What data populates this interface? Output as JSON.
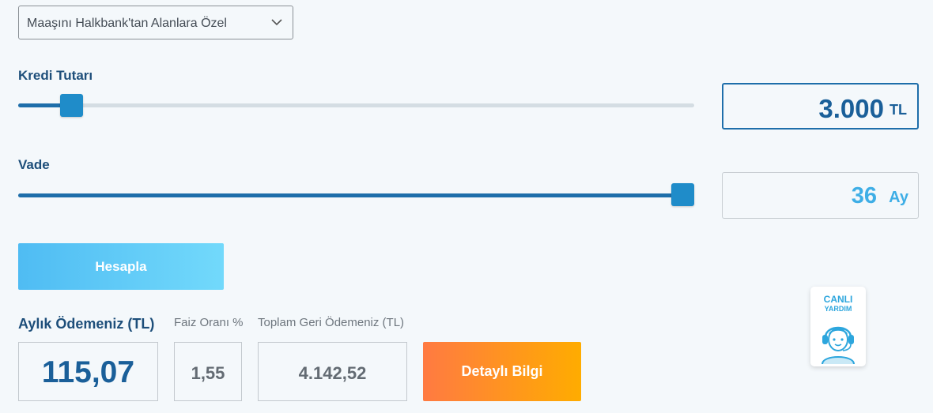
{
  "loan_type_select": {
    "selected": "Maaşını Halkbank'tan Alanlara Özel"
  },
  "amount": {
    "label": "Kredi Tutarı",
    "value": "3.000",
    "unit": "TL",
    "slider_fraction": 0.04
  },
  "term": {
    "label": "Vade",
    "value": "36",
    "unit": "Ay",
    "slider_fraction": 1.0
  },
  "calculate_button": {
    "label": "Hesapla"
  },
  "results": {
    "monthly_label": "Aylık Ödemeniz (TL)",
    "monthly_value": "115,07",
    "rate_label": "Faiz Oranı %",
    "rate_value": "1,55",
    "total_label": "Toplam Geri Ödemeniz (TL)",
    "total_value": "4.142,52"
  },
  "detail_button": {
    "label": "Detaylı Bilgi"
  },
  "live_help": {
    "line1": "CANLI",
    "line2": "YARDIM"
  },
  "icons": [
    "chevron-down-icon",
    "support-agent-icon"
  ],
  "colors": {
    "primary": "#1e6eaa",
    "thumb": "#1f8cc9",
    "accent_blue": "#4fbcf3",
    "accent_orange": "#ff7a42"
  }
}
